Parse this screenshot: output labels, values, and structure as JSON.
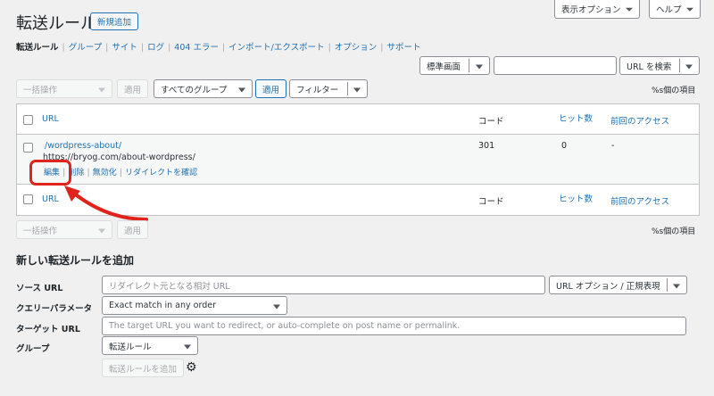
{
  "header": {
    "title": "転送ルール",
    "add_new": "新規追加",
    "screen_options": "表示オプション",
    "help": "ヘルプ"
  },
  "nav": {
    "items": [
      "転送ルール",
      "グループ",
      "サイト",
      "ログ",
      "404 エラー",
      "インポート/エクスポート",
      "オプション",
      "サポート"
    ]
  },
  "search": {
    "view_select": "標準画面",
    "query": "",
    "search_select": "URL を検索"
  },
  "top_actions": {
    "bulk": "一括操作",
    "apply": "適用",
    "group_filter": "すべてのグループ",
    "apply2": "適用",
    "filter": "フィルター",
    "items_count": "%s個の項目"
  },
  "table": {
    "headers": {
      "url": "URL",
      "code": "コード",
      "hits": "ヒット数",
      "last_access": "前回のアクセス"
    },
    "rows": [
      {
        "source": "/wordpress-about/",
        "target": "https://bryog.com/about-wordpress/",
        "code": "301",
        "hits": "0",
        "last_access": "-",
        "actions": {
          "edit": "編集",
          "delete": "削除",
          "disable": "無効化",
          "check": "リダイレクトを確認"
        }
      }
    ]
  },
  "bottom_actions": {
    "bulk": "一括操作",
    "apply": "適用",
    "items_count": "%s個の項目"
  },
  "form": {
    "heading": "新しい転送ルールを追加",
    "source_label": "ソース URL",
    "source_placeholder": "リダイレクト元となる相対 URL",
    "url_options": "URL オプション / 正規表現",
    "query_label": "クエリーパラメータ",
    "query_value": "Exact match in any order",
    "target_label": "ターゲット URL",
    "target_placeholder": "The target URL you want to redirect, or auto-complete on post name or permalink.",
    "group_label": "グループ",
    "group_value": "転送ルール",
    "submit": "転送ルールを追加"
  },
  "colors": {
    "accent": "#2271b1",
    "highlight": "#e0241b"
  },
  "icons": [
    "gear-icon",
    "arrow-annotation"
  ]
}
